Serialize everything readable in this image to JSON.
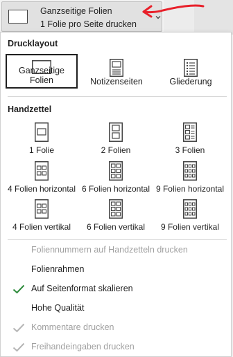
{
  "dropdown": {
    "line1": "Ganzseitige Folien",
    "line2": "1 Folie pro Seite drucken"
  },
  "colors": {
    "annotation": "#e8202a",
    "check_enabled": "#2e8b3c",
    "check_disabled": "#b5b5b5",
    "disabled_text": "#a0a0a0"
  },
  "menu": {
    "print_layout": {
      "title": "Drucklayout",
      "items": [
        {
          "label": "Ganzseitige Folien",
          "icon": "full-slide-icon",
          "selected": true
        },
        {
          "label": "Notizenseiten",
          "icon": "notes-page-icon",
          "selected": false
        },
        {
          "label": "Gliederung",
          "icon": "outline-icon",
          "selected": false
        }
      ]
    },
    "handouts": {
      "title": "Handzettel",
      "items": [
        {
          "label": "1 Folie",
          "icon": "handout-1-icon"
        },
        {
          "label": "2 Folien",
          "icon": "handout-2-icon"
        },
        {
          "label": "3 Folien",
          "icon": "handout-3-icon"
        },
        {
          "label": "4 Folien horizontal",
          "icon": "handout-4h-icon"
        },
        {
          "label": "6 Folien horizontal",
          "icon": "handout-6h-icon"
        },
        {
          "label": "9 Folien horizontal",
          "icon": "handout-9h-icon"
        },
        {
          "label": "4 Folien vertikal",
          "icon": "handout-4v-icon"
        },
        {
          "label": "6 Folien vertikal",
          "icon": "handout-6v-icon"
        },
        {
          "label": "9 Folien vertikal",
          "icon": "handout-9v-icon"
        }
      ]
    },
    "options": [
      {
        "label": "Foliennummern auf Handzetteln drucken",
        "checked": false,
        "enabled": false
      },
      {
        "label": "Folienrahmen",
        "checked": false,
        "enabled": true
      },
      {
        "label": "Auf Seitenformat skalieren",
        "checked": true,
        "enabled": true
      },
      {
        "label": "Hohe Qualität",
        "checked": false,
        "enabled": true
      },
      {
        "label": "Kommentare drucken",
        "checked": true,
        "enabled": false
      },
      {
        "label": "Freihandeingaben drucken",
        "checked": true,
        "enabled": false
      }
    ]
  }
}
